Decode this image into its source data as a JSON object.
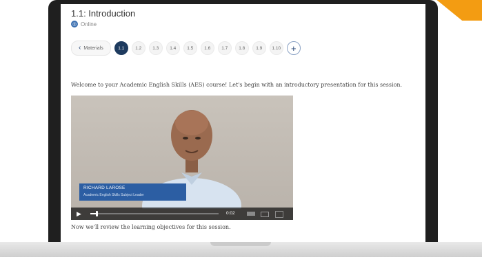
{
  "course": {
    "section_title": "1.1: Introduction",
    "mode": "Online"
  },
  "nav": {
    "back_label": "Materials",
    "sections": [
      "1.1",
      "1.2",
      "1.3",
      "1.4",
      "1.5",
      "1.6",
      "1.7",
      "1.8",
      "1.9",
      "1.10"
    ],
    "active_section": "1.1"
  },
  "content": {
    "intro_text": "Welcome to your Academic English Skills (AES) course! Let's begin with an introductory presentation for this session.",
    "objectives_text": "Now we'll review the learning objectives for this session."
  },
  "video": {
    "presenter_name": "RICHARD LAROSE",
    "presenter_role": "Academic English Skills Subject Leader",
    "current_time": "0:02",
    "progress": 0.05
  },
  "colors": {
    "accent": "#1e3b5f",
    "nametag": "#2c5ea3",
    "corner": "#f39c12"
  }
}
